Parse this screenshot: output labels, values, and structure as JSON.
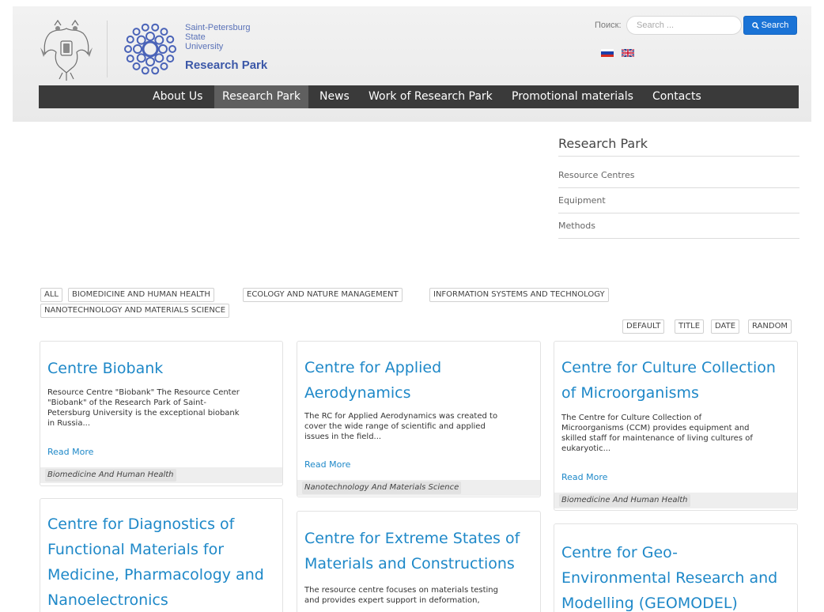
{
  "header": {
    "logo_lines": [
      "Saint-Petersburg",
      "State",
      "University"
    ],
    "logo_title": "Research Park",
    "search_label": "Поиск:",
    "search_placeholder": "Search ...",
    "search_button": "Search"
  },
  "nav": [
    "About Us",
    "Research Park",
    "News",
    "Work of Research Park",
    "Promotional materials",
    "Contacts"
  ],
  "nav_active": "Research Park",
  "sidebar": {
    "title": "Research Park",
    "items": [
      "Resource Centres",
      "Equipment",
      "Methods"
    ]
  },
  "filters": [
    "ALL",
    "BIOMEDICINE AND HUMAN HEALTH",
    "ECOLOGY AND NATURE MANAGEMENT",
    "INFORMATION SYSTEMS AND TECHNOLOGY",
    "NANOTECHNOLOGY AND MATERIALS SCIENCE"
  ],
  "sorts": [
    "DEFAULT",
    "TITLE",
    "DATE",
    "RANDOM"
  ],
  "cards": [
    {
      "title_lines": [
        "Centre Biobank"
      ],
      "text_lines": [
        "Resource Centre \"Biobank\" The Resource Center",
        "\"Biobank\" of the Research Park of Saint-",
        "Petersburg University is the exceptional biobank",
        "in Russia..."
      ],
      "read_more": "Read More",
      "tag": "Biomedicine And Human Health"
    },
    {
      "title_lines": [
        "Centre for Applied",
        "Aerodynamics"
      ],
      "text_lines": [
        "The RC for Applied Aerodynamics was created to",
        "cover the wide range of scientific and applied",
        "issues in the field..."
      ],
      "read_more": "Read More",
      "tag": "Nanotechnology And Materials Science"
    },
    {
      "title_lines": [
        "Centre for Culture Collection",
        "of Microorganisms"
      ],
      "text_lines": [
        "The Centre for Culture Collection of",
        "Microorganisms (CCM) provides equipment and",
        "skilled staff for maintenance of living cultures of",
        "eukaryotic..."
      ],
      "read_more": "Read More",
      "tag": "Biomedicine And Human Health"
    },
    {
      "title_lines": [
        "Centre for Diagnostics of",
        "Functional Materials for",
        "Medicine, Pharmacology and",
        "Nanoelectronics"
      ],
      "text_lines": []
    },
    {
      "title_lines": [
        "Centre for Extreme States of",
        "Materials and Constructions"
      ],
      "text_lines": [
        "The resource centre focuses on materials testing",
        "and provides expert support in deformation,"
      ]
    },
    {
      "title_lines": [
        "Centre for Geo-",
        "Environmental Research and",
        "Modelling (GEOMODEL)"
      ],
      "text_lines": []
    }
  ],
  "colors": {
    "link": "#1e88c8",
    "nav_bg": "#3a3a3a",
    "search_button": "#1a73d6",
    "logo": "#3c58a8"
  }
}
